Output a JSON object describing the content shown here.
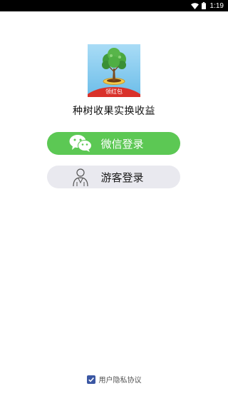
{
  "status_bar": {
    "time": "1:19",
    "wifi_icon": "wifi-icon",
    "battery_icon": "battery-icon"
  },
  "app": {
    "logo_badge": "领红包",
    "title": "种树收果实换收益"
  },
  "login": {
    "wechat_label": "微信登录",
    "wechat_icon": "wechat-icon",
    "guest_label": "游客登录",
    "guest_icon": "person-icon"
  },
  "privacy": {
    "checked": true,
    "label": "用户隐私协议"
  },
  "colors": {
    "wechat_green": "#5cc854",
    "guest_gray": "#e9e9ef",
    "checkbox_blue": "#3b57a3",
    "logo_sky": "#7fc8ef",
    "logo_red": "#d9312a"
  }
}
